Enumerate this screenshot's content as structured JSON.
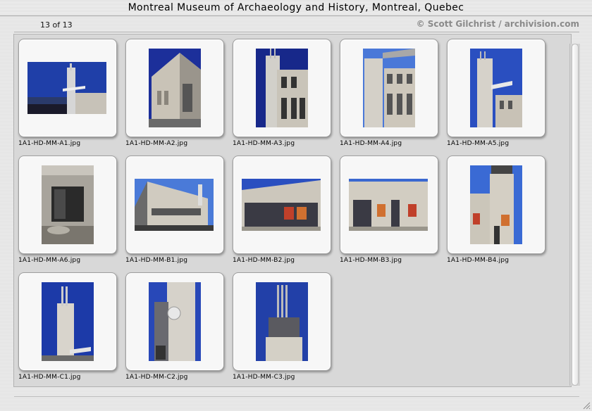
{
  "window": {
    "title": "Montreal Museum of Archaeology and History, Montreal, Quebec",
    "counter": "13 of 13",
    "credit": "© Scott Gilchrist / archivision.com"
  },
  "thumbnails": [
    {
      "filename": "1A1-HD-MM-A1.jpg",
      "icon": "building-photo-icon"
    },
    {
      "filename": "1A1-HD-MM-A2.jpg",
      "icon": "building-photo-icon"
    },
    {
      "filename": "1A1-HD-MM-A3.jpg",
      "icon": "building-photo-icon"
    },
    {
      "filename": "1A1-HD-MM-A4.jpg",
      "icon": "building-photo-icon"
    },
    {
      "filename": "1A1-HD-MM-A5.jpg",
      "icon": "building-photo-icon"
    },
    {
      "filename": "1A1-HD-MM-A6.jpg",
      "icon": "building-photo-icon"
    },
    {
      "filename": "1A1-HD-MM-B1.jpg",
      "icon": "building-photo-icon"
    },
    {
      "filename": "1A1-HD-MM-B2.jpg",
      "icon": "building-photo-icon"
    },
    {
      "filename": "1A1-HD-MM-B3.jpg",
      "icon": "building-photo-icon"
    },
    {
      "filename": "1A1-HD-MM-B4.jpg",
      "icon": "building-photo-icon"
    },
    {
      "filename": "1A1-HD-MM-C1.jpg",
      "icon": "building-photo-icon"
    },
    {
      "filename": "1A1-HD-MM-C2.jpg",
      "icon": "building-photo-icon"
    },
    {
      "filename": "1A1-HD-MM-C3.jpg",
      "icon": "building-photo-icon"
    }
  ],
  "colors": {
    "sky": "#1f3fa8",
    "sky_light": "#4a78d8",
    "stone": "#cfc8ba"
  }
}
